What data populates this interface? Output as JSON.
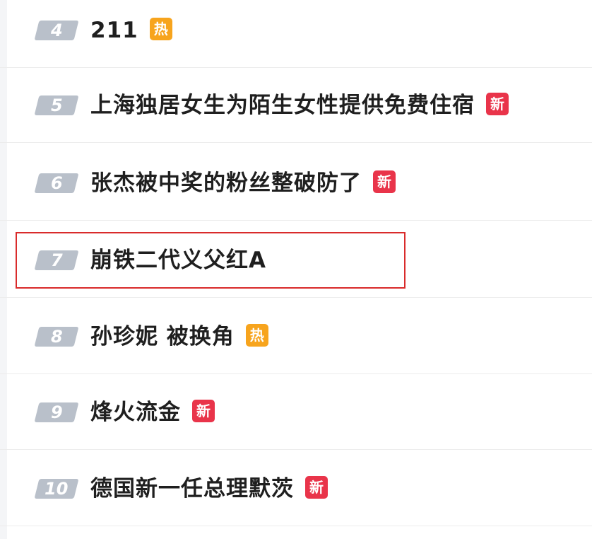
{
  "hot_list": {
    "items": [
      {
        "rank": "4",
        "title": "211",
        "badge": "热",
        "badge_type": "hot"
      },
      {
        "rank": "5",
        "title": "上海独居女生为陌生女性提供免费住宿",
        "badge": "新",
        "badge_type": "new"
      },
      {
        "rank": "6",
        "title": "张杰被中奖的粉丝整破防了",
        "badge": "新",
        "badge_type": "new"
      },
      {
        "rank": "7",
        "title": "崩铁二代义父红A",
        "badge": "",
        "badge_type": "none",
        "highlighted": true
      },
      {
        "rank": "8",
        "title": "孙珍妮 被换角",
        "badge": "热",
        "badge_type": "hot"
      },
      {
        "rank": "9",
        "title": "烽火流金",
        "badge": "新",
        "badge_type": "new"
      },
      {
        "rank": "10",
        "title": "德国新一任总理默茨",
        "badge": "新",
        "badge_type": "new"
      }
    ]
  },
  "colors": {
    "rank_bg": "#b9c0ca",
    "hot_badge": "#f7a41d",
    "new_badge": "#e9344a",
    "highlight_border": "#d92b2b",
    "title_text": "#1f1f1f"
  }
}
